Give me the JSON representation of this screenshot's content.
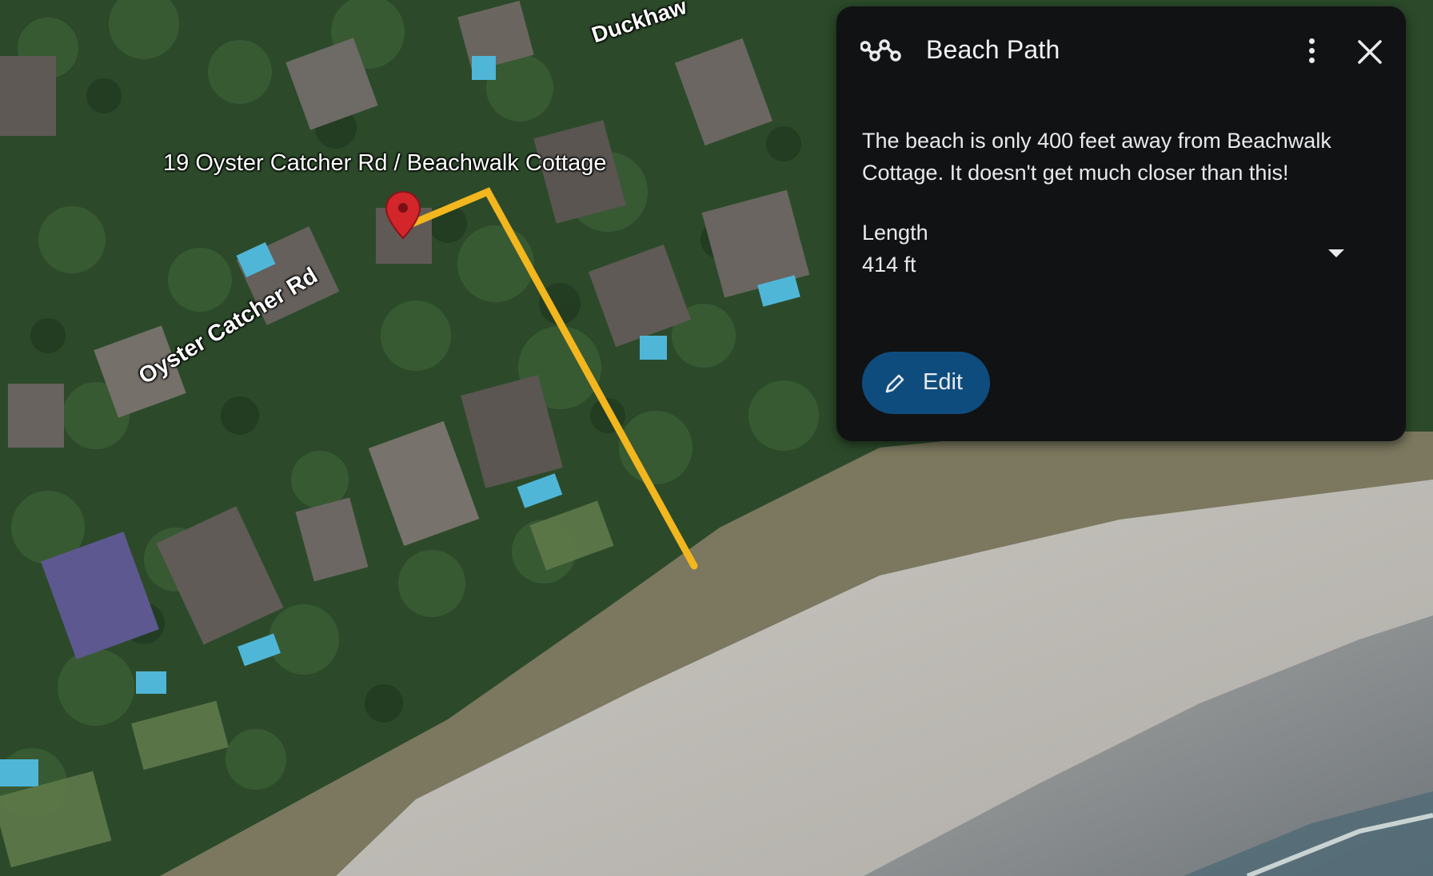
{
  "map": {
    "place_label": "19 Oyster Catcher Rd / Beachwalk Cottage",
    "road_label": "Oyster Catcher Rd",
    "top_road_label": "Duckhaw"
  },
  "panel": {
    "title": "Beach Path",
    "title_icon": "route-icon",
    "description": "The beach is only 400 feet away from Beachwalk Cottage.  It doesn't get much closer than this!",
    "length_label": "Length",
    "length_value": "414 ft",
    "edit_label": "Edit",
    "more_icon": "more-vert-icon",
    "close_icon": "close-icon",
    "dropdown_icon": "arrow-drop-down-icon",
    "edit_icon": "pencil-icon"
  },
  "colors": {
    "panel_bg": "#111213",
    "edit_button": "#0f4c7e",
    "path_line": "#f2b61f",
    "pin": "#d3262b"
  }
}
